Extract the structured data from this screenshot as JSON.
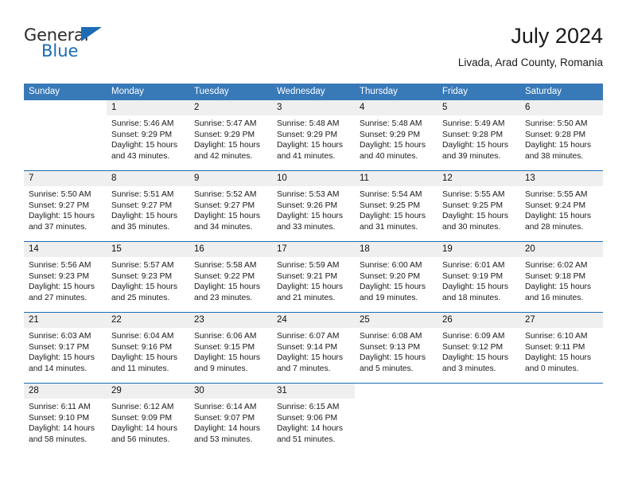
{
  "brand": {
    "name_part1": "General",
    "name_part2": "Blue",
    "accent_color": "#1b6cb5"
  },
  "header": {
    "title": "July 2024",
    "subtitle": "Livada, Arad County, Romania"
  },
  "calendar": {
    "header_bg": "#3879b8",
    "weekday_headers": [
      "Sunday",
      "Monday",
      "Tuesday",
      "Wednesday",
      "Thursday",
      "Friday",
      "Saturday"
    ],
    "weeks": [
      [
        {
          "day": "",
          "empty": true
        },
        {
          "day": "1",
          "sunrise": "Sunrise: 5:46 AM",
          "sunset": "Sunset: 9:29 PM",
          "daylight1": "Daylight: 15 hours",
          "daylight2": "and 43 minutes."
        },
        {
          "day": "2",
          "sunrise": "Sunrise: 5:47 AM",
          "sunset": "Sunset: 9:29 PM",
          "daylight1": "Daylight: 15 hours",
          "daylight2": "and 42 minutes."
        },
        {
          "day": "3",
          "sunrise": "Sunrise: 5:48 AM",
          "sunset": "Sunset: 9:29 PM",
          "daylight1": "Daylight: 15 hours",
          "daylight2": "and 41 minutes."
        },
        {
          "day": "4",
          "sunrise": "Sunrise: 5:48 AM",
          "sunset": "Sunset: 9:29 PM",
          "daylight1": "Daylight: 15 hours",
          "daylight2": "and 40 minutes."
        },
        {
          "day": "5",
          "sunrise": "Sunrise: 5:49 AM",
          "sunset": "Sunset: 9:28 PM",
          "daylight1": "Daylight: 15 hours",
          "daylight2": "and 39 minutes."
        },
        {
          "day": "6",
          "sunrise": "Sunrise: 5:50 AM",
          "sunset": "Sunset: 9:28 PM",
          "daylight1": "Daylight: 15 hours",
          "daylight2": "and 38 minutes."
        }
      ],
      [
        {
          "day": "7",
          "sunrise": "Sunrise: 5:50 AM",
          "sunset": "Sunset: 9:27 PM",
          "daylight1": "Daylight: 15 hours",
          "daylight2": "and 37 minutes."
        },
        {
          "day": "8",
          "sunrise": "Sunrise: 5:51 AM",
          "sunset": "Sunset: 9:27 PM",
          "daylight1": "Daylight: 15 hours",
          "daylight2": "and 35 minutes."
        },
        {
          "day": "9",
          "sunrise": "Sunrise: 5:52 AM",
          "sunset": "Sunset: 9:27 PM",
          "daylight1": "Daylight: 15 hours",
          "daylight2": "and 34 minutes."
        },
        {
          "day": "10",
          "sunrise": "Sunrise: 5:53 AM",
          "sunset": "Sunset: 9:26 PM",
          "daylight1": "Daylight: 15 hours",
          "daylight2": "and 33 minutes."
        },
        {
          "day": "11",
          "sunrise": "Sunrise: 5:54 AM",
          "sunset": "Sunset: 9:25 PM",
          "daylight1": "Daylight: 15 hours",
          "daylight2": "and 31 minutes."
        },
        {
          "day": "12",
          "sunrise": "Sunrise: 5:55 AM",
          "sunset": "Sunset: 9:25 PM",
          "daylight1": "Daylight: 15 hours",
          "daylight2": "and 30 minutes."
        },
        {
          "day": "13",
          "sunrise": "Sunrise: 5:55 AM",
          "sunset": "Sunset: 9:24 PM",
          "daylight1": "Daylight: 15 hours",
          "daylight2": "and 28 minutes."
        }
      ],
      [
        {
          "day": "14",
          "sunrise": "Sunrise: 5:56 AM",
          "sunset": "Sunset: 9:23 PM",
          "daylight1": "Daylight: 15 hours",
          "daylight2": "and 27 minutes."
        },
        {
          "day": "15",
          "sunrise": "Sunrise: 5:57 AM",
          "sunset": "Sunset: 9:23 PM",
          "daylight1": "Daylight: 15 hours",
          "daylight2": "and 25 minutes."
        },
        {
          "day": "16",
          "sunrise": "Sunrise: 5:58 AM",
          "sunset": "Sunset: 9:22 PM",
          "daylight1": "Daylight: 15 hours",
          "daylight2": "and 23 minutes."
        },
        {
          "day": "17",
          "sunrise": "Sunrise: 5:59 AM",
          "sunset": "Sunset: 9:21 PM",
          "daylight1": "Daylight: 15 hours",
          "daylight2": "and 21 minutes."
        },
        {
          "day": "18",
          "sunrise": "Sunrise: 6:00 AM",
          "sunset": "Sunset: 9:20 PM",
          "daylight1": "Daylight: 15 hours",
          "daylight2": "and 19 minutes."
        },
        {
          "day": "19",
          "sunrise": "Sunrise: 6:01 AM",
          "sunset": "Sunset: 9:19 PM",
          "daylight1": "Daylight: 15 hours",
          "daylight2": "and 18 minutes."
        },
        {
          "day": "20",
          "sunrise": "Sunrise: 6:02 AM",
          "sunset": "Sunset: 9:18 PM",
          "daylight1": "Daylight: 15 hours",
          "daylight2": "and 16 minutes."
        }
      ],
      [
        {
          "day": "21",
          "sunrise": "Sunrise: 6:03 AM",
          "sunset": "Sunset: 9:17 PM",
          "daylight1": "Daylight: 15 hours",
          "daylight2": "and 14 minutes."
        },
        {
          "day": "22",
          "sunrise": "Sunrise: 6:04 AM",
          "sunset": "Sunset: 9:16 PM",
          "daylight1": "Daylight: 15 hours",
          "daylight2": "and 11 minutes."
        },
        {
          "day": "23",
          "sunrise": "Sunrise: 6:06 AM",
          "sunset": "Sunset: 9:15 PM",
          "daylight1": "Daylight: 15 hours",
          "daylight2": "and 9 minutes."
        },
        {
          "day": "24",
          "sunrise": "Sunrise: 6:07 AM",
          "sunset": "Sunset: 9:14 PM",
          "daylight1": "Daylight: 15 hours",
          "daylight2": "and 7 minutes."
        },
        {
          "day": "25",
          "sunrise": "Sunrise: 6:08 AM",
          "sunset": "Sunset: 9:13 PM",
          "daylight1": "Daylight: 15 hours",
          "daylight2": "and 5 minutes."
        },
        {
          "day": "26",
          "sunrise": "Sunrise: 6:09 AM",
          "sunset": "Sunset: 9:12 PM",
          "daylight1": "Daylight: 15 hours",
          "daylight2": "and 3 minutes."
        },
        {
          "day": "27",
          "sunrise": "Sunrise: 6:10 AM",
          "sunset": "Sunset: 9:11 PM",
          "daylight1": "Daylight: 15 hours",
          "daylight2": "and 0 minutes."
        }
      ],
      [
        {
          "day": "28",
          "sunrise": "Sunrise: 6:11 AM",
          "sunset": "Sunset: 9:10 PM",
          "daylight1": "Daylight: 14 hours",
          "daylight2": "and 58 minutes."
        },
        {
          "day": "29",
          "sunrise": "Sunrise: 6:12 AM",
          "sunset": "Sunset: 9:09 PM",
          "daylight1": "Daylight: 14 hours",
          "daylight2": "and 56 minutes."
        },
        {
          "day": "30",
          "sunrise": "Sunrise: 6:14 AM",
          "sunset": "Sunset: 9:07 PM",
          "daylight1": "Daylight: 14 hours",
          "daylight2": "and 53 minutes."
        },
        {
          "day": "31",
          "sunrise": "Sunrise: 6:15 AM",
          "sunset": "Sunset: 9:06 PM",
          "daylight1": "Daylight: 14 hours",
          "daylight2": "and 51 minutes."
        },
        {
          "day": "",
          "empty": true
        },
        {
          "day": "",
          "empty": true
        },
        {
          "day": "",
          "empty": true
        }
      ]
    ]
  }
}
